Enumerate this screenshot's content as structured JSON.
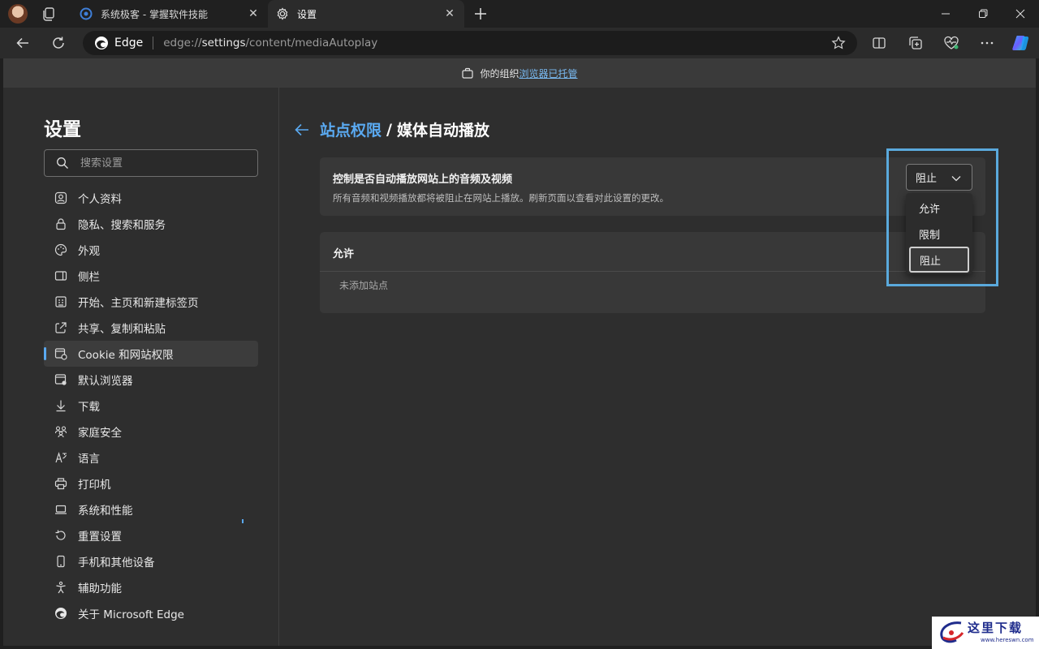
{
  "browser": {
    "tabs": [
      {
        "title": "系统极客 - 掌握软件技能",
        "active": false
      },
      {
        "title": "设置",
        "active": true
      }
    ],
    "omnibox": {
      "brand": "Edge",
      "url_prefix": "edge://",
      "url_host": "settings",
      "url_path": "/content/mediaAutoplay"
    },
    "managed_bar": {
      "prefix": "你的组织",
      "link": "浏览器已托管"
    }
  },
  "sidebar": {
    "title": "设置",
    "search_placeholder": "搜索设置",
    "items": [
      {
        "label": "个人资料",
        "icon": "profile-icon"
      },
      {
        "label": "隐私、搜索和服务",
        "icon": "lock-icon"
      },
      {
        "label": "外观",
        "icon": "palette-icon"
      },
      {
        "label": "侧栏",
        "icon": "sidebar-icon"
      },
      {
        "label": "开始、主页和新建标签页",
        "icon": "home-grid-icon"
      },
      {
        "label": "共享、复制和粘贴",
        "icon": "share-icon"
      },
      {
        "label": "Cookie 和网站权限",
        "icon": "site-permissions-icon",
        "active": true
      },
      {
        "label": "默认浏览器",
        "icon": "browser-icon"
      },
      {
        "label": "下载",
        "icon": "download-icon"
      },
      {
        "label": "家庭安全",
        "icon": "family-icon"
      },
      {
        "label": "语言",
        "icon": "language-icon"
      },
      {
        "label": "打印机",
        "icon": "printer-icon"
      },
      {
        "label": "系统和性能",
        "icon": "laptop-icon"
      },
      {
        "label": "重置设置",
        "icon": "reset-icon"
      },
      {
        "label": "手机和其他设备",
        "icon": "phone-icon"
      },
      {
        "label": "辅助功能",
        "icon": "accessibility-icon"
      },
      {
        "label": "关于 Microsoft Edge",
        "icon": "edge-icon"
      }
    ]
  },
  "main": {
    "breadcrumb_parent": "站点权限",
    "breadcrumb_separator": "/",
    "breadcrumb_current": "媒体自动播放",
    "setting": {
      "title": "控制是否自动播放网站上的音频及视频",
      "description": "所有音频和视频播放都将被阻止在网站上播放。刷新页面以查看对此设置的更改。",
      "selected": "阻止",
      "options": [
        "允许",
        "限制",
        "阻止"
      ]
    },
    "allow_section": {
      "title": "允许",
      "empty_text": "未添加站点"
    }
  },
  "watermark": {
    "text": "这里下载",
    "url": "www.hereswn.com"
  },
  "colors": {
    "accent": "#5aa9f0",
    "highlight_border": "#5aa9dc",
    "page_bg": "#2e2e2e",
    "card_bg": "#383838"
  }
}
